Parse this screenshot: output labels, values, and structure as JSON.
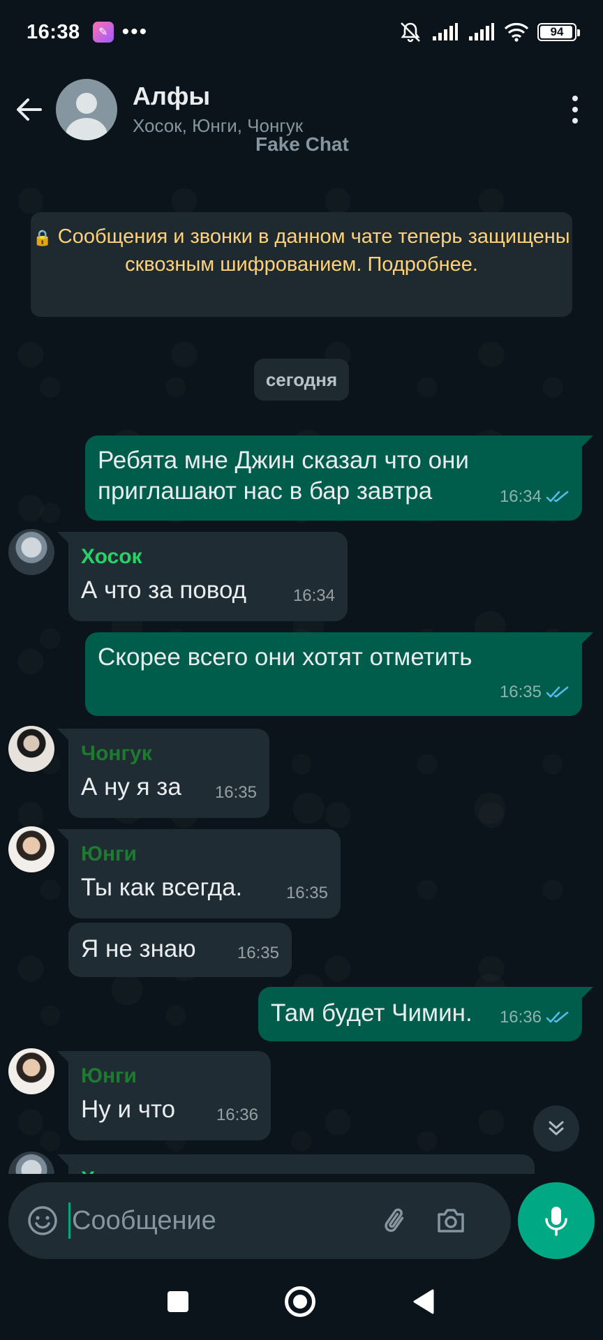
{
  "status_bar": {
    "time": "16:38",
    "dots": "•••",
    "battery": "94"
  },
  "header": {
    "title": "Алфы",
    "members": "Хосок, Юнги, Чонгук",
    "watermark": "Fake Chat"
  },
  "banner": {
    "lock_icon": "🔒",
    "text": "Сообщения и звонки в данном чате теперь защищены сквозным шифрованием. Подробнее."
  },
  "date_chip": "сегодня",
  "messages": [
    {
      "direction": "out",
      "text_line1": "Ребята мне Джин сказал что они",
      "text_line2": "приглашают нас в бар завтра",
      "time": "16:34"
    },
    {
      "direction": "in",
      "sender": "Хосок",
      "sender_color": "#25d366",
      "text": "А что за повод",
      "time": "16:34"
    },
    {
      "direction": "out",
      "text": "Скорее всего они хотят отметить",
      "time": "16:35"
    },
    {
      "direction": "in",
      "sender": "Чонгук",
      "sender_color": "#1e7a2e",
      "text": "А ну я за",
      "time": "16:35"
    },
    {
      "direction": "in",
      "sender": "Юнги",
      "sender_color": "#1e7a2e",
      "text": "Ты как всегда.",
      "time": "16:35"
    },
    {
      "direction": "in",
      "text": "Я не знаю",
      "time": "16:35"
    },
    {
      "direction": "out",
      "text": "Там будет Чимин.",
      "time": "16:36"
    },
    {
      "direction": "in",
      "sender": "Юнги",
      "sender_color": "#1e7a2e",
      "text": "Ну и что",
      "time": "16:36"
    },
    {
      "direction": "in",
      "sender": "Хосок",
      "sender_color": "#25d366",
      "partial": true
    }
  ],
  "composer": {
    "placeholder": "Сообщение"
  },
  "colors": {
    "background": "#0b141a",
    "outgoing_bubble": "#005c4b",
    "incoming_bubble": "#1f2c34",
    "accent": "#00a884",
    "read_ticks": "#53bdeb",
    "banner_text": "#ffd279"
  },
  "icons": [
    "back-arrow-icon",
    "more-vert-icon",
    "lock-icon",
    "double-check-icon",
    "chevron-double-down-icon",
    "emoji-icon",
    "attach-icon",
    "camera-icon",
    "mic-icon"
  ]
}
